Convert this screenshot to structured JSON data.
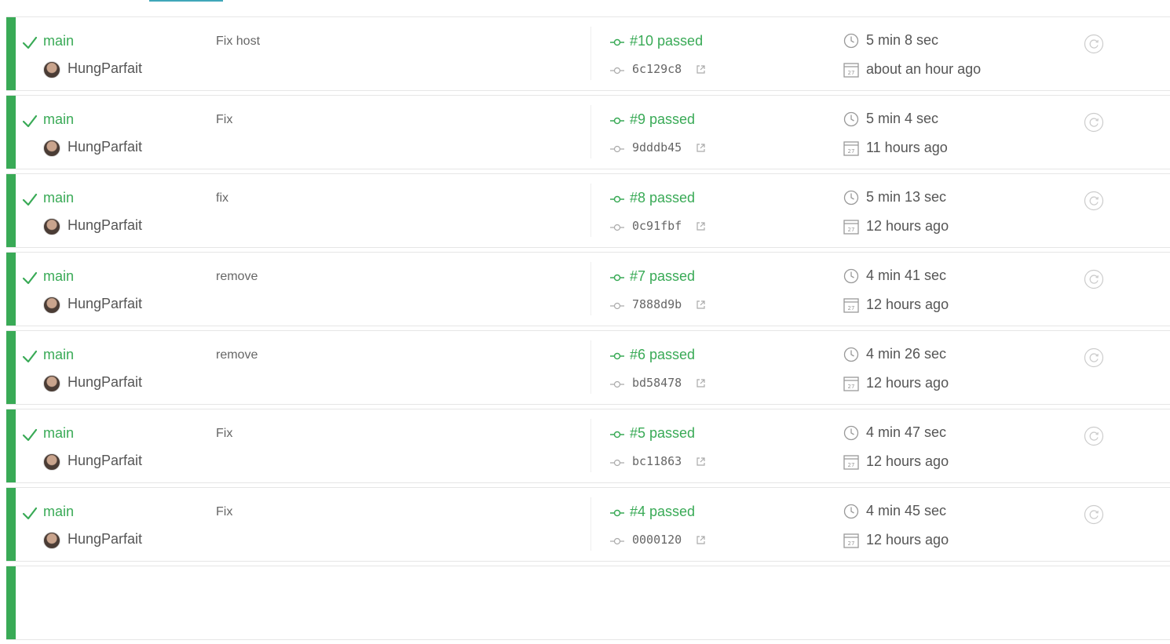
{
  "colors": {
    "passed": "#39aa56",
    "tab_accent": "#3fa7b9",
    "text": "#555555",
    "muted": "#aaaaaa"
  },
  "icons": {
    "status": "check-icon",
    "commit": "commit-icon",
    "external": "external-link-icon",
    "duration": "clock-icon",
    "date": "calendar-icon",
    "restart": "restart-icon"
  },
  "calendar_icon_label": "27",
  "builds": [
    {
      "branch": "main",
      "author": "HungParfait",
      "message": "Fix host",
      "status": "#10 passed",
      "sha": "6c129c8",
      "duration": "5 min 8 sec",
      "finished": "about an hour ago"
    },
    {
      "branch": "main",
      "author": "HungParfait",
      "message": "Fix",
      "status": "#9 passed",
      "sha": "9dddb45",
      "duration": "5 min 4 sec",
      "finished": "11 hours ago"
    },
    {
      "branch": "main",
      "author": "HungParfait",
      "message": "fix",
      "status": "#8 passed",
      "sha": "0c91fbf",
      "duration": "5 min 13 sec",
      "finished": "12 hours ago"
    },
    {
      "branch": "main",
      "author": "HungParfait",
      "message": "remove",
      "status": "#7 passed",
      "sha": "7888d9b",
      "duration": "4 min 41 sec",
      "finished": "12 hours ago"
    },
    {
      "branch": "main",
      "author": "HungParfait",
      "message": "remove",
      "status": "#6 passed",
      "sha": "bd58478",
      "duration": "4 min 26 sec",
      "finished": "12 hours ago"
    },
    {
      "branch": "main",
      "author": "HungParfait",
      "message": "Fix",
      "status": "#5 passed",
      "sha": "bc11863",
      "duration": "4 min 47 sec",
      "finished": "12 hours ago"
    },
    {
      "branch": "main",
      "author": "HungParfait",
      "message": "Fix",
      "status": "#4 passed",
      "sha": "0000120",
      "duration": "4 min 45 sec",
      "finished": "12 hours ago"
    }
  ]
}
